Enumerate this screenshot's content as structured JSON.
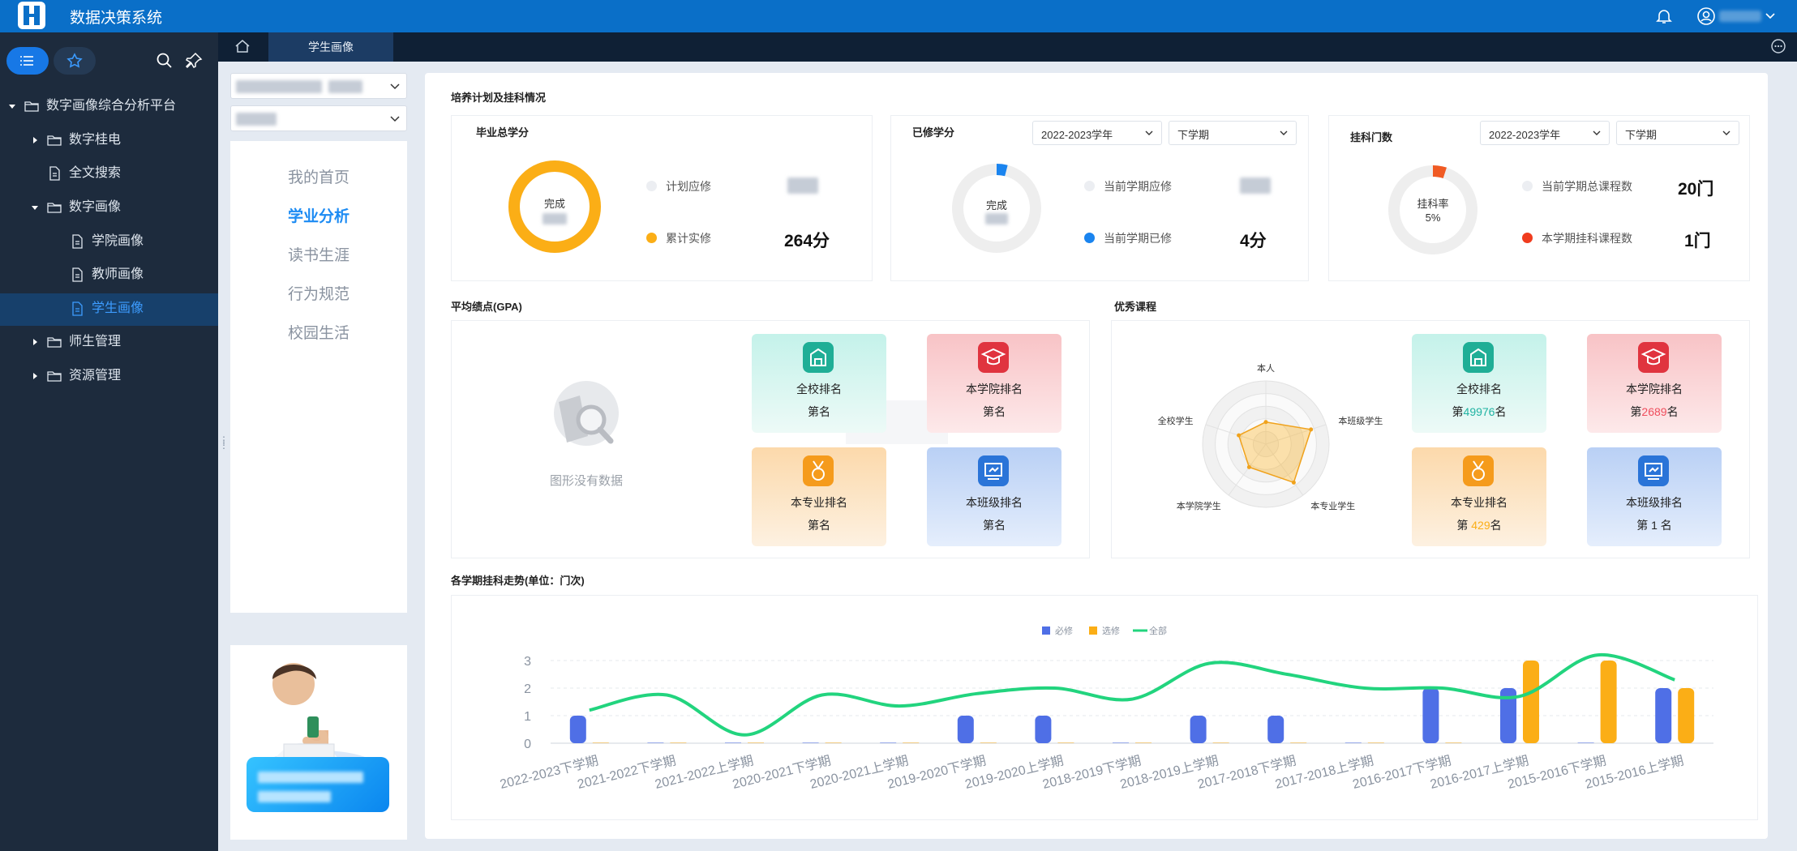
{
  "app": {
    "title": "数据决策系统"
  },
  "tree": [
    {
      "label": "数字画像综合分析平台"
    },
    {
      "label": "数字桂电"
    },
    {
      "label": "全文搜索"
    },
    {
      "label": "数字画像"
    },
    {
      "label": "学院画像"
    },
    {
      "label": "教师画像"
    },
    {
      "label": "学生画像"
    },
    {
      "label": "师生管理"
    },
    {
      "label": "资源管理"
    }
  ],
  "tabs": {
    "active": "学生画像"
  },
  "left_nav": [
    "我的首页",
    "学业分析",
    "读书生涯",
    "行为规范",
    "校园生活"
  ],
  "sections": {
    "plan": "培养计划及挂科情况",
    "gpa": "平均绩点(GPA)",
    "excellent": "优秀课程",
    "trend": "各学期挂科走势(单位：门次)"
  },
  "credits": {
    "title": "毕业总学分",
    "center": "完成",
    "planned_label": "计划应修",
    "earned_label": "累计实修",
    "earned_value": "264分",
    "completion_pct": 100
  },
  "term_credits": {
    "title": "已修学分",
    "year": "2022-2023学年",
    "term": "下学期",
    "center": "完成",
    "should_label": "当前学期应修",
    "done_label": "当前学期已修",
    "done_value": "4分",
    "completion_pct": 4
  },
  "fails": {
    "title": "挂科门数",
    "year": "2022-2023学年",
    "term": "下学期",
    "center_label": "挂科率",
    "center_value": "5%",
    "total_label": "当前学期总课程数",
    "total_value": "20门",
    "failed_label": "本学期挂科课程数",
    "failed_value": "1门",
    "rate_pct": 5
  },
  "gpa": {
    "empty_text": "图形没有数据",
    "ranks": [
      {
        "title": "全校排名",
        "value": "第名"
      },
      {
        "title": "本学院排名",
        "value": "第名"
      },
      {
        "title": "本专业排名",
        "value": "第名"
      },
      {
        "title": "本班级排名",
        "value": "第名"
      }
    ]
  },
  "excellent": {
    "radar_labels": [
      "本人",
      "本班级学生",
      "本专业学生",
      "本学院学生",
      "全校学生"
    ],
    "radar_values": [
      0.35,
      0.75,
      0.75,
      0.45,
      0.45
    ],
    "ranks": [
      {
        "title": "全校排名",
        "prefix": "第",
        "num": "49976",
        "suffix": "名"
      },
      {
        "title": "本学院排名",
        "prefix": "第",
        "num": "2689",
        "suffix": "名"
      },
      {
        "title": "本专业排名",
        "prefix": "第 ",
        "num": "429",
        "suffix": "名"
      },
      {
        "title": "本班级排名",
        "prefix": "第 ",
        "num": "1",
        "suffix": " 名"
      }
    ]
  },
  "colors": {
    "brand": "#0a6fc8",
    "accent": "#1778e6",
    "required": "#4f6fe6",
    "elective": "#fbae16",
    "total": "#22d47e",
    "rank_num_green": "#20b3a2",
    "rank_num_red": "#ef4e5d",
    "rank_num_orange": "#fbae16"
  },
  "chart_data": {
    "type": "bar",
    "title": "",
    "categories": [
      "2022-2023下学期",
      "2021-2022下学期",
      "2021-2022上学期",
      "2020-2021下学期",
      "2020-2021上学期",
      "2019-2020下学期",
      "2019-2020上学期",
      "2018-2019下学期",
      "2018-2019上学期",
      "2017-2018下学期",
      "2017-2018上学期",
      "2016-2017下学期",
      "2016-2017上学期",
      "2015-2016下学期",
      "2015-2016上学期"
    ],
    "series": [
      {
        "name": "必修",
        "type": "bar",
        "values": [
          1,
          0,
          0,
          0,
          0,
          1,
          1,
          0,
          1,
          1,
          0,
          2,
          2,
          0,
          2
        ]
      },
      {
        "name": "选修",
        "type": "bar",
        "values": [
          0,
          0,
          0,
          0,
          0,
          0,
          0,
          0,
          0,
          0,
          0,
          0,
          3,
          3,
          2
        ]
      },
      {
        "name": "全部",
        "type": "line",
        "values": [
          1.2,
          1.75,
          0.3,
          1.75,
          1.35,
          1.8,
          2.0,
          1.6,
          2.9,
          2.5,
          2.0,
          2.0,
          1.7,
          3.2,
          2.3
        ]
      }
    ],
    "ylim": [
      0,
      3
    ],
    "yticks": [
      "0",
      "1",
      "2",
      "3"
    ],
    "legend": "top-center"
  }
}
